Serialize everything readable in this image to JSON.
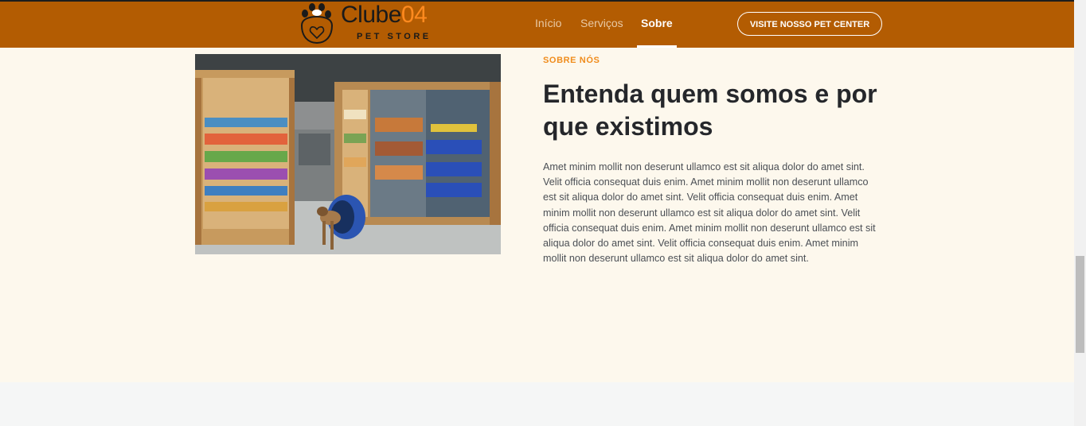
{
  "header": {
    "logo": {
      "name_main": "Clube",
      "name_accent": "04",
      "tagline": "PET STORE"
    },
    "nav": [
      {
        "label": "Início",
        "active": false
      },
      {
        "label": "Serviços",
        "active": false
      },
      {
        "label": "Sobre",
        "active": true
      }
    ],
    "cta_label": "VISITE NOSSO PET CENTER"
  },
  "about": {
    "kicker": "SOBRE NÓS",
    "title": "Entenda quem somos e por que existimos",
    "body": "Amet minim mollit non deserunt ullamco est sit aliqua dolor do amet sint. Velit officia consequat duis enim. Amet minim mollit non deserunt ullamco est sit aliqua dolor do amet sint. Velit officia consequat duis enim. Amet minim mollit non deserunt ullamco est sit aliqua dolor do amet sint. Velit officia consequat duis enim. Amet minim mollit non deserunt ullamco est sit aliqua dolor do amet sint. Velit officia consequat duis enim. Amet minim mollit non deserunt ullamco est sit aliqua dolor do amet sint."
  },
  "colors": {
    "header_bg": "#b35c02",
    "accent": "#f08c1c",
    "section_bg": "#fdf8ed",
    "title": "#25272b"
  }
}
